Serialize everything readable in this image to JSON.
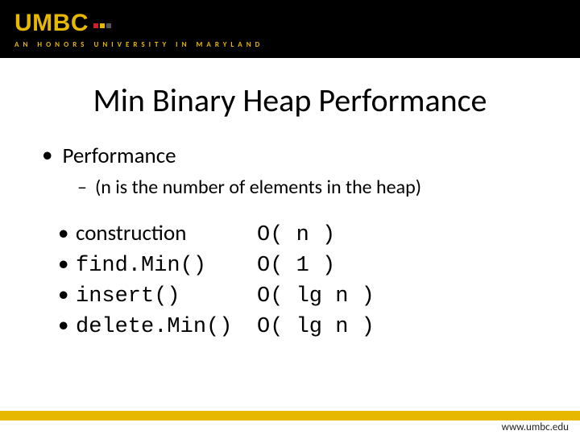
{
  "header": {
    "logo_text": "UMBC",
    "tagline": "AN HONORS UNIVERSITY IN MARYLAND"
  },
  "title": "Min Binary Heap Performance",
  "bullets": {
    "lvl1": "Performance",
    "lvl2": "(n is the number of elements in the heap)"
  },
  "ops": [
    {
      "label": "construction",
      "label_mono": false,
      "complexity": "O( n )"
    },
    {
      "label": "find.Min()",
      "label_mono": true,
      "complexity": "O( 1 )"
    },
    {
      "label": "insert()",
      "label_mono": true,
      "complexity": "O( lg n )"
    },
    {
      "label": "delete.Min()",
      "label_mono": true,
      "complexity": "O( lg n )"
    }
  ],
  "footer": {
    "url": "www.umbc.edu"
  },
  "colors": {
    "gold": "#e6b800",
    "black": "#000000"
  }
}
